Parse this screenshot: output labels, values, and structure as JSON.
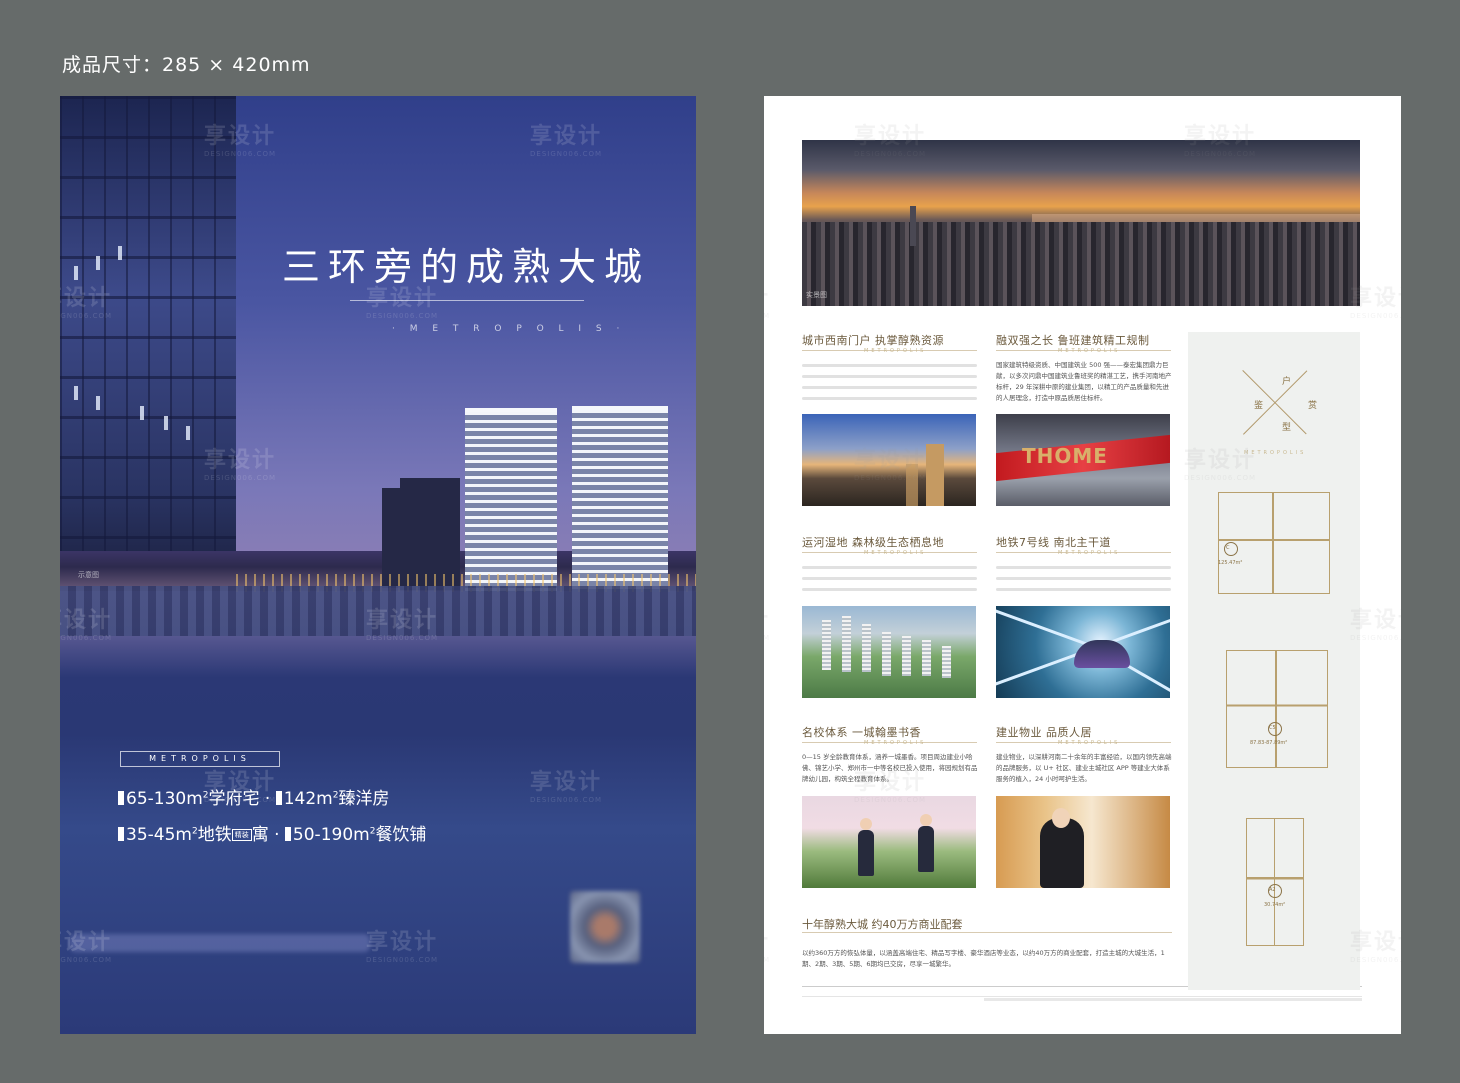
{
  "spec_label": "成品尺寸：285 × 420mm",
  "front": {
    "headline": "三环旁的成熟大城",
    "subline": "· M E T R O P O L I S ·",
    "tag": "METROPOLIS",
    "photo_caption": "示意图",
    "features_line1": [
      {
        "prefix": "65-130m",
        "sup": "2",
        "suffix": "学府宅"
      },
      {
        "prefix": "142m",
        "sup": "2",
        "suffix": "臻洋房"
      }
    ],
    "features_line2": [
      {
        "prefix": "35-45m",
        "sup": "2",
        "suffix": "地铁",
        "box": "精装",
        "tail": "寓"
      },
      {
        "prefix": "50-190m",
        "sup": "2",
        "suffix": "餐饮铺"
      }
    ]
  },
  "back": {
    "hero_caption": "实景图",
    "sections": [
      {
        "title": "城市西南门户  执掌醇熟资源",
        "sub": "METROPOLIS"
      },
      {
        "title": "融双强之长  鲁班建筑精工规制",
        "sub": "METROPOLIS",
        "body": "国家建筑特级资质、中国建筑业 500 强——泰宏集团鼎力巨献，以多次问鼎中国建筑业鲁班奖的精湛工艺，携手河南地产标杆，29 年深耕中原的建业集团，以精工的产品质量和先进的人居理念，打造中原品质居住标杆。"
      },
      {
        "title": "运河湿地  森林级生态栖息地",
        "sub": "METROPOLIS"
      },
      {
        "title": "地铁7号线  南北主干道",
        "sub": "METROPOLIS"
      },
      {
        "title": "名校体系  一城翰墨书香",
        "sub": "METROPOLIS",
        "body": "0—15 岁全龄教育体系，涵养一城墨香。项目周边建业小哈佛、锦艺小学、郑州市一中等名校已投入使用，将园规划有品牌幼儿园，构筑全程教育体系。"
      },
      {
        "title": "建业物业  品质人居",
        "sub": "METROPOLIS",
        "body": "建业物业，以深耕河南二十余年的丰富经验，以国内领先高端的品牌服务，以 U+ 社区、建业主城社区 APP 等建业大体系服务的植入，24 小时呵护生活。"
      }
    ],
    "commerce_title": "十年醇熟大城  约40万方商业配套",
    "commerce_body": "以约360万方的恢弘体量，以涵盖高端住宅、精品写字楼、豪华酒店等业态，以约40万方的商业配套，打造主城的大城生活，1期、2期、3期、5期、6期均已交房，尽享一城繁华。",
    "panel": {
      "chars": [
        "户",
        "鉴",
        "赏",
        "型"
      ],
      "sub": "METROPOLIS",
      "plans": [
        {
          "code": "C",
          "area": "125.47m²"
        },
        {
          "code": "C5",
          "area": "87.83-87.89m²"
        },
        {
          "code": "A2",
          "area": "30.74m²"
        }
      ]
    }
  },
  "watermark": {
    "text": "享设计",
    "url": "DESIGN006.COM"
  }
}
